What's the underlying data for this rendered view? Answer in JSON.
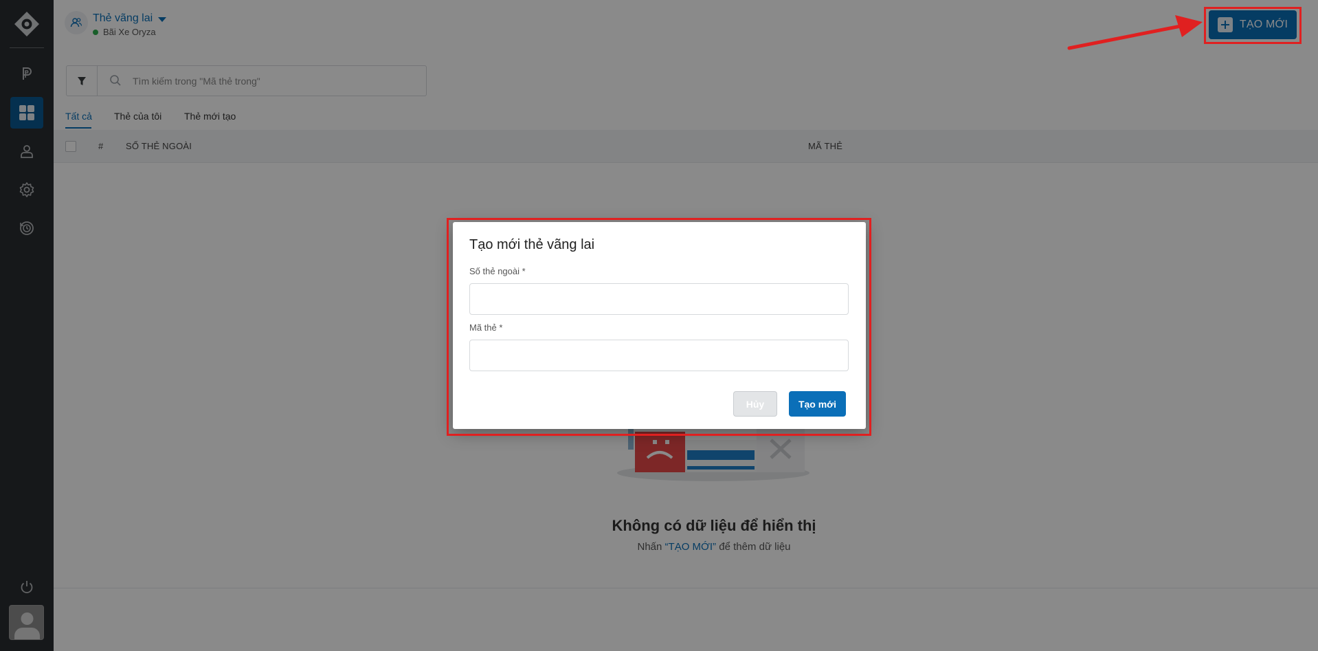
{
  "header": {
    "title": "Thẻ vãng lai",
    "subtitle": "Bãi Xe Oryza",
    "create_button": "TẠO MỚI"
  },
  "search": {
    "placeholder": "Tìm kiếm trong \"Mã thẻ trong\""
  },
  "tabs": [
    {
      "label": "Tất cả",
      "active": true
    },
    {
      "label": "Thẻ của tôi",
      "active": false
    },
    {
      "label": "Thẻ mới tạo",
      "active": false
    }
  ],
  "table": {
    "columns": [
      "#",
      "SỐ THẺ NGOÀI",
      "MÃ THẺ"
    ]
  },
  "empty_state": {
    "title": "Không có dữ liệu để hiển thị",
    "sub_prefix": "Nhấn ",
    "sub_link": "“TẠO MỚI”",
    "sub_suffix": " để thêm dữ liệu"
  },
  "modal": {
    "title": "Tạo mới thẻ vãng lai",
    "field1_label": "Số thẻ ngoài *",
    "field1_value": "",
    "field2_label": "Mã thẻ *",
    "field2_value": "",
    "cancel_label": "Hủy",
    "submit_label": "Tạo mới"
  },
  "colors": {
    "sidebar_bg": "#2a2d30",
    "accent": "#0b6fb8",
    "highlight": "#e02020",
    "status_online": "#2eae4e"
  }
}
